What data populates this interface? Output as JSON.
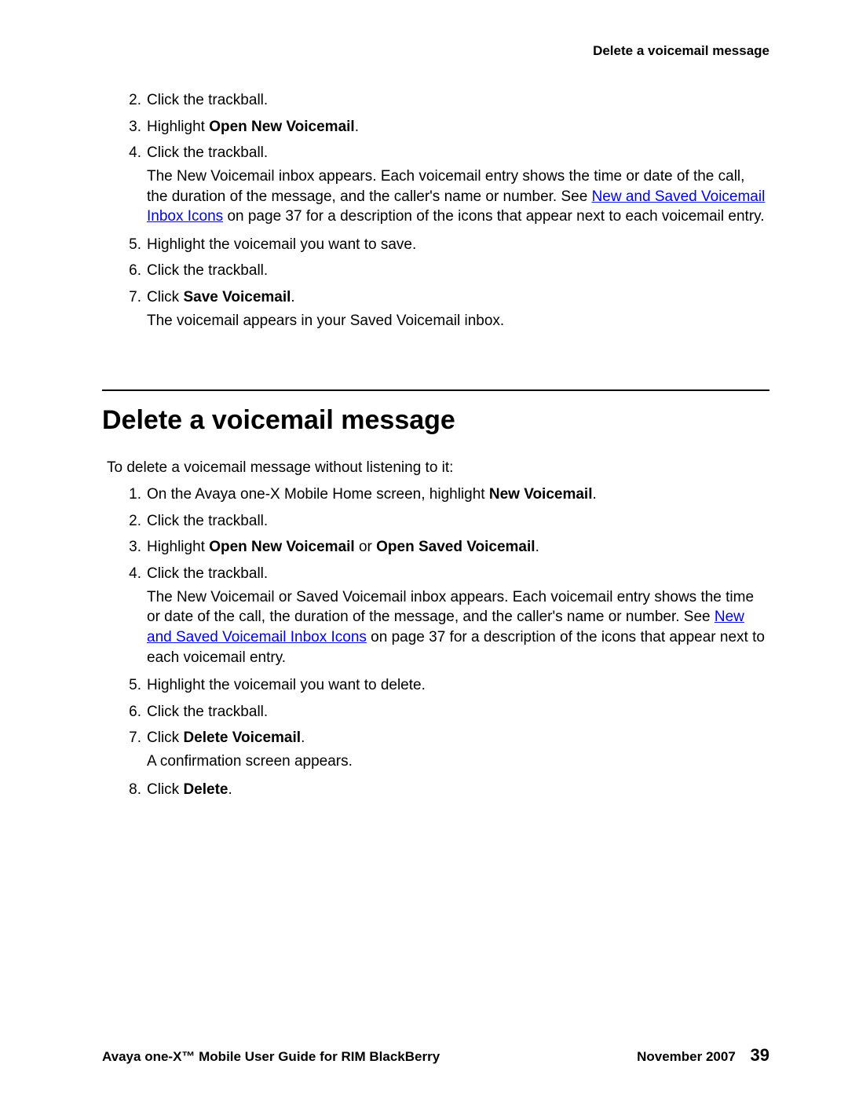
{
  "header": {
    "running_title": "Delete a voicemail message"
  },
  "section_save": {
    "step2_num": "2.",
    "step2_text": "Click the trackball.",
    "step3_num": "3.",
    "step3_pre": "Highlight ",
    "step3_bold": "Open New Voicemail",
    "step3_post": ".",
    "step4_num": "4.",
    "step4_text": "Click the trackball.",
    "step4_sub_a": "The New Voicemail inbox appears. Each voicemail entry shows the time or date of the call, the duration of the message, and the caller's name or number. See ",
    "step4_link": "New and Saved Voicemail Inbox Icons",
    "step4_sub_b": " on page 37 for a description of the icons that appear next to each voicemail entry.",
    "step5_num": "5.",
    "step5_text": "Highlight the voicemail you want to save.",
    "step6_num": "6.",
    "step6_text": "Click the trackball.",
    "step7_num": "7.",
    "step7_pre": "Click ",
    "step7_bold": "Save Voicemail",
    "step7_post": ".",
    "step7_sub": "The voicemail appears in your Saved Voicemail inbox."
  },
  "section_delete": {
    "heading": "Delete a voicemail message",
    "intro": "To delete a voicemail message without listening to it:",
    "step1_num": "1.",
    "step1_pre": "On the Avaya one-X Mobile Home screen, highlight ",
    "step1_bold": "New Voicemail",
    "step1_post": ".",
    "step2_num": "2.",
    "step2_text": "Click the trackball.",
    "step3_num": "3.",
    "step3_pre": "Highlight ",
    "step3_bold1": "Open New Voicemail",
    "step3_mid": " or ",
    "step3_bold2": "Open Saved Voicemail",
    "step3_post": ".",
    "step4_num": "4.",
    "step4_text": "Click the trackball.",
    "step4_sub_a": "The New Voicemail or Saved Voicemail inbox appears. Each voicemail entry shows the time or date of the call, the duration of the message, and the caller's name or number. See ",
    "step4_link": "New and Saved Voicemail Inbox Icons",
    "step4_sub_b": " on page 37 for a description of the icons that appear next to each voicemail entry.",
    "step5_num": "5.",
    "step5_text": "Highlight the voicemail you want to delete.",
    "step6_num": "6.",
    "step6_text": "Click the trackball.",
    "step7_num": "7.",
    "step7_pre": "Click ",
    "step7_bold": "Delete Voicemail",
    "step7_post": ".",
    "step7_sub": "A confirmation screen appears.",
    "step8_num": "8.",
    "step8_pre": "Click ",
    "step8_bold": "Delete",
    "step8_post": "."
  },
  "footer": {
    "left": "Avaya one-X™ Mobile User Guide for RIM BlackBerry",
    "date": "November 2007",
    "page": "39"
  }
}
